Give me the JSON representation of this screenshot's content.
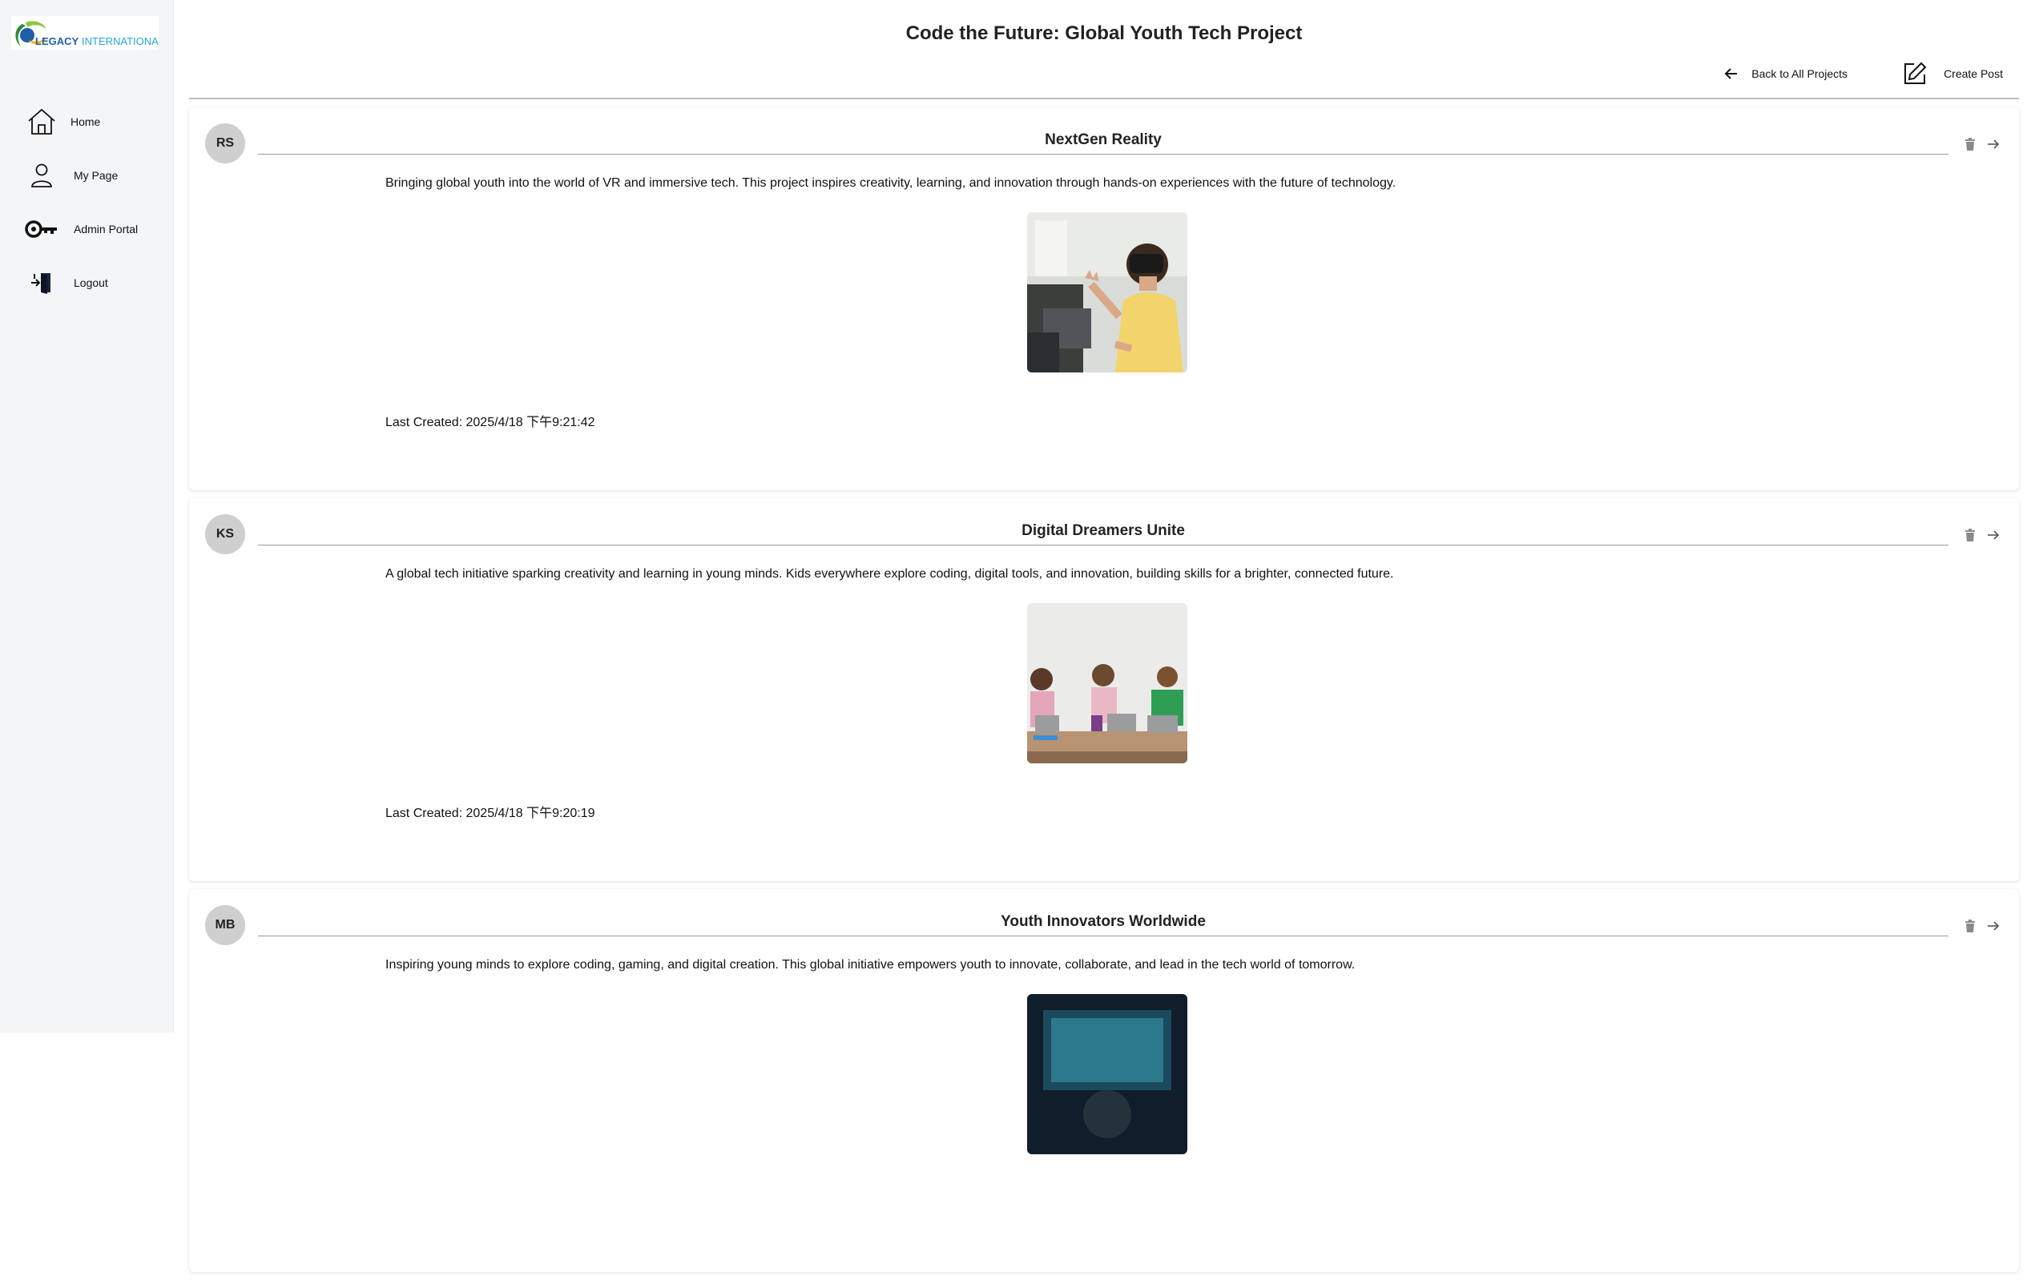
{
  "sidebar": {
    "logo_text": "LEGACY INTERNATIONAL",
    "items": [
      {
        "label": "Home",
        "icon": "home-icon"
      },
      {
        "label": "My Page",
        "icon": "user-icon"
      },
      {
        "label": "Admin Portal",
        "icon": "key-icon"
      },
      {
        "label": "Logout",
        "icon": "logout-icon"
      }
    ]
  },
  "header": {
    "title": "Code the Future: Global Youth Tech Project",
    "back_label": "Back to All Projects",
    "create_label": "Create Post"
  },
  "posts": [
    {
      "initials": "RS",
      "title": "NextGen Reality",
      "description": "Bringing global youth into the world of VR and immersive tech. This project inspires creativity, learning, and innovation through hands-on experiences with the future of technology.",
      "date": "Last Created: 2025/4/18 下午9:21:42",
      "image": "child-wearing-vr-headset-photo"
    },
    {
      "initials": "KS",
      "title": "Digital Dreamers Unite",
      "description": "A global tech initiative sparking creativity and learning in young minds. Kids everywhere explore coding, digital tools, and innovation, building skills for a brighter, connected future.",
      "date": "Last Created: 2025/4/18 下午9:20:19",
      "image": "kids-with-laptops-photo"
    },
    {
      "initials": "MB",
      "title": "Youth Innovators Worldwide",
      "description": "Inspiring young minds to explore coding, gaming, and digital creation. This global initiative empowers youth to innovate, collaborate, and lead in the tech world of tomorrow.",
      "date": "",
      "image": "youth-gaming-photo"
    }
  ],
  "colors": {
    "sidebar_bg": "#f4f5f7",
    "avatar_bg": "#cfcfcf",
    "logo_green": "#2e8b3e",
    "logo_blue": "#1f5fa8"
  }
}
